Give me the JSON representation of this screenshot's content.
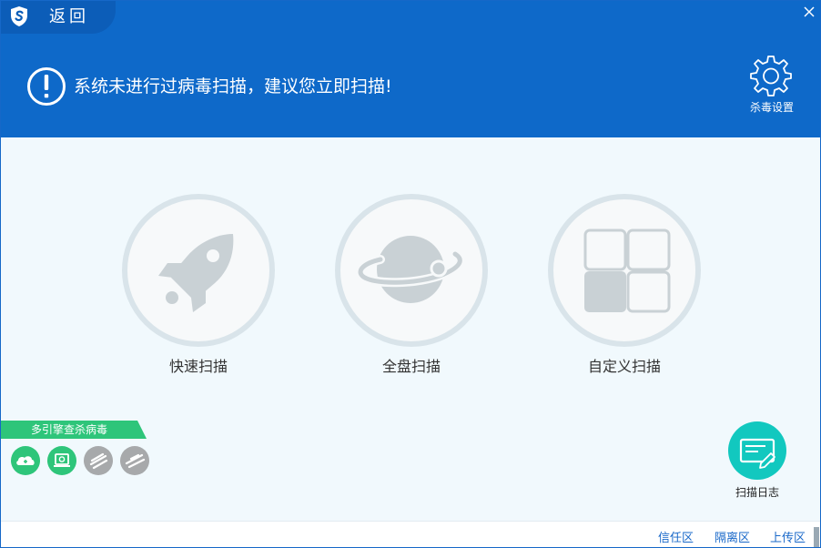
{
  "header": {
    "back_label": "返回",
    "alert_text": "系统未进行过病毒扫描，建议您立即扫描!",
    "settings_label": "杀毒设置"
  },
  "scan_options": [
    {
      "label": "快速扫描",
      "icon": "rocket-icon"
    },
    {
      "label": "全盘扫描",
      "icon": "planet-icon"
    },
    {
      "label": "自定义扫描",
      "icon": "grid-icon"
    }
  ],
  "engines": {
    "title": "多引擎查杀病毒",
    "icons": [
      "cloud-engine-icon",
      "local-engine-icon",
      "engine-3-icon",
      "engine-4-icon"
    ]
  },
  "scan_log": {
    "label": "扫描日志"
  },
  "footer": {
    "links": [
      "信任区",
      "隔离区",
      "上传区"
    ]
  },
  "colors": {
    "header_blue": "#0e69c9",
    "body_bg": "#f1f9fd",
    "engine_green": "#2ec57a",
    "log_teal": "#12c8bf",
    "link_blue": "#1968c9"
  }
}
